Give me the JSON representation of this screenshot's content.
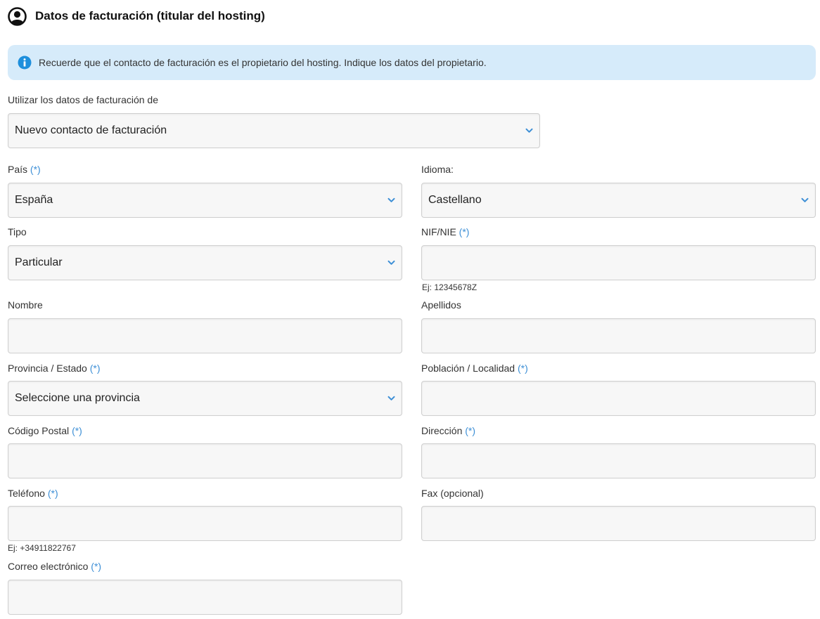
{
  "header": {
    "title": "Datos de facturación (titular del hosting)",
    "icon": "user-circle-icon"
  },
  "notice": {
    "icon": "info-icon",
    "text": "Recuerde que el contacto de facturación es el propietario del hosting. Indique los datos del propietario.",
    "background": "#d6ebfa",
    "icon_color": "#1e8fdc"
  },
  "required_mark": "(*)",
  "accent_color": "#3d8fd6",
  "billing_source": {
    "label": "Utilizar los datos de facturación de",
    "value": "Nuevo contacto de facturación"
  },
  "fields": {
    "pais": {
      "label": "País",
      "value": "España"
    },
    "idioma": {
      "label": "Idioma:",
      "value": "Castellano"
    },
    "tipo": {
      "label": "Tipo",
      "value": "Particular"
    },
    "nif": {
      "label": "NIF/NIE",
      "value": "",
      "hint": "Ej: 12345678Z"
    },
    "nombre": {
      "label": "Nombre",
      "value": ""
    },
    "apellidos": {
      "label": "Apellidos",
      "value": ""
    },
    "provincia": {
      "label": "Provincia / Estado",
      "value": "Seleccione una provincia"
    },
    "poblacion": {
      "label": "Población / Localidad",
      "value": ""
    },
    "codigo_postal": {
      "label": "Código Postal",
      "value": ""
    },
    "direccion": {
      "label": "Dirección",
      "value": ""
    },
    "telefono": {
      "label": "Teléfono",
      "value": "",
      "hint": "Ej: +34911822767"
    },
    "fax": {
      "label": "Fax (opcional)",
      "value": ""
    },
    "correo": {
      "label": "Correo electrónico",
      "value": ""
    }
  }
}
